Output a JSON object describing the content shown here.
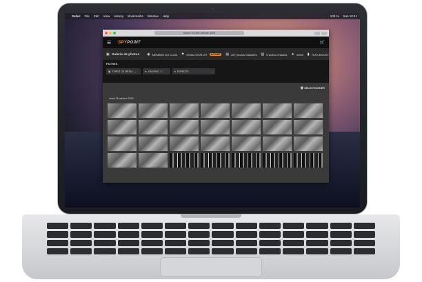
{
  "menubar": {
    "items": [
      "Safari",
      "File",
      "Edit",
      "View",
      "History",
      "Bookmarks",
      "Window",
      "Help"
    ],
    "status": [
      "100 %",
      "Sun 10:41"
    ]
  },
  "browser": {
    "url": "Search or enter website name"
  },
  "site": {
    "logo_a": "SPY",
    "logo_b": "POINT",
    "gallery_title": "Galerie de photos",
    "header_items": [
      {
        "icon": "member-icon",
        "label": "MEMBRE DU CLUB"
      },
      {
        "icon": "trial-icon",
        "label": "ESSAI GRATUIT"
      },
      {
        "icon": "photo-count-icon",
        "label": "267 photos restantes"
      },
      {
        "icon": "video-count-icon",
        "label": "5 vidéos restants"
      },
      {
        "icon": "star-icon",
        "label": "0/500"
      },
      {
        "icon": "flex-icon",
        "label": "FLEX-BOOST"
      }
    ],
    "trial_badge": "ACTIVÉE",
    "filters": {
      "title": "FILTRES",
      "media_type": "TYPES DE MÉDIA",
      "favorites": "FAVORIS",
      "species": "ESPÈCES"
    },
    "select_label": "SÉLECTIONNER",
    "date_label": "Jeudi 26 octobre 2023",
    "thumbnails": [
      "day",
      "day",
      "day",
      "day",
      "day",
      "day",
      "day",
      "day",
      "day",
      "day",
      "day",
      "day",
      "day",
      "day",
      "day",
      "day",
      "day",
      "day",
      "day",
      "day",
      "day",
      "day",
      "day",
      "night",
      "night",
      "night",
      "night",
      "night"
    ]
  },
  "colors": {
    "accent": "#f08a1c",
    "page_bg": "#1e1e1f"
  }
}
